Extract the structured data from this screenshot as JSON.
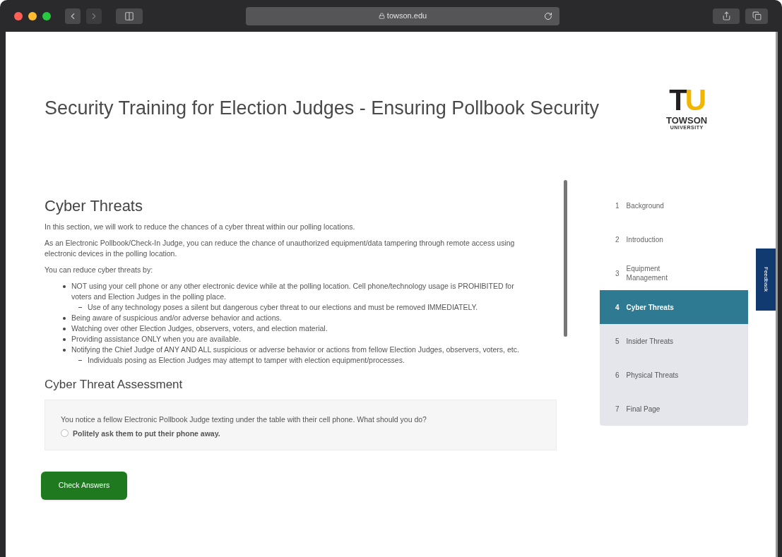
{
  "browser": {
    "url": "towson.edu"
  },
  "page_title": "Security Training for Election Judges - Ensuring Pollbook Security",
  "logo": {
    "letters": [
      {
        "text": "T",
        "color": "#231f20"
      },
      {
        "text": "U",
        "color": "#f2b600"
      }
    ],
    "name": "TOWSON",
    "subtitle": "UNIVERSITY"
  },
  "section": {
    "heading": "Cyber Threats",
    "blocks": [
      {
        "kind": "paragraph",
        "text": "In this section, we will work to reduce the chances of a cyber threat within our polling locations."
      },
      {
        "kind": "paragraph",
        "text": "As an Electronic Pollbook/Check-In Judge, you can reduce the chance of unauthorized equipment/data tampering through remote access using electronic devices in the polling location."
      },
      {
        "kind": "paragraph",
        "text": "You can reduce cyber threats by:"
      },
      {
        "kind": "list",
        "items": [
          {
            "text": "NOT using your cell phone or any other electronic device while at the polling location. Cell phone/technology usage is PROHIBITED for voters and Election Judges in the polling place.",
            "children": [
              {
                "text": "Use of any technology poses a silent but dangerous cyber threat to our elections and must be removed IMMEDIATELY."
              }
            ]
          },
          {
            "text": "Being aware of suspicious and/or adverse behavior and actions."
          },
          {
            "text": "Watching over other Election Judges, observers, voters, and election material."
          },
          {
            "text": "Providing assistance ONLY when you are available."
          },
          {
            "text": "Notifying the Chief Judge of ANY AND ALL suspicious or adverse behavior or actions from fellow Election Judges, observers, voters, etc.",
            "children": [
              {
                "text": "Individuals posing as Election Judges may attempt to tamper with election equipment/processes."
              }
            ]
          }
        ]
      }
    ]
  },
  "assessment": {
    "heading": "Cyber Threat Assessment",
    "question": "You notice a fellow Electronic Pollbook Judge texting under the table with their cell phone. What should you do?",
    "options": [
      {
        "label": "Politely ask them to put their phone away.",
        "selected": false
      }
    ],
    "button": "Check Answers"
  },
  "nav": [
    {
      "number": "1",
      "label": "Background",
      "selected": false
    },
    {
      "number": "2",
      "label": "Introduction",
      "selected": false
    },
    {
      "number": "3",
      "label": "Equipment Management",
      "selected": false
    },
    {
      "number": "4",
      "label": "Cyber Threats",
      "selected": true
    },
    {
      "number": "5",
      "label": "Insider Threats",
      "selected": false
    },
    {
      "number": "6",
      "label": "Physical Threats",
      "selected": false
    },
    {
      "number": "7",
      "label": "Final Page",
      "selected": false
    }
  ],
  "feedback_tab": "Feedback"
}
